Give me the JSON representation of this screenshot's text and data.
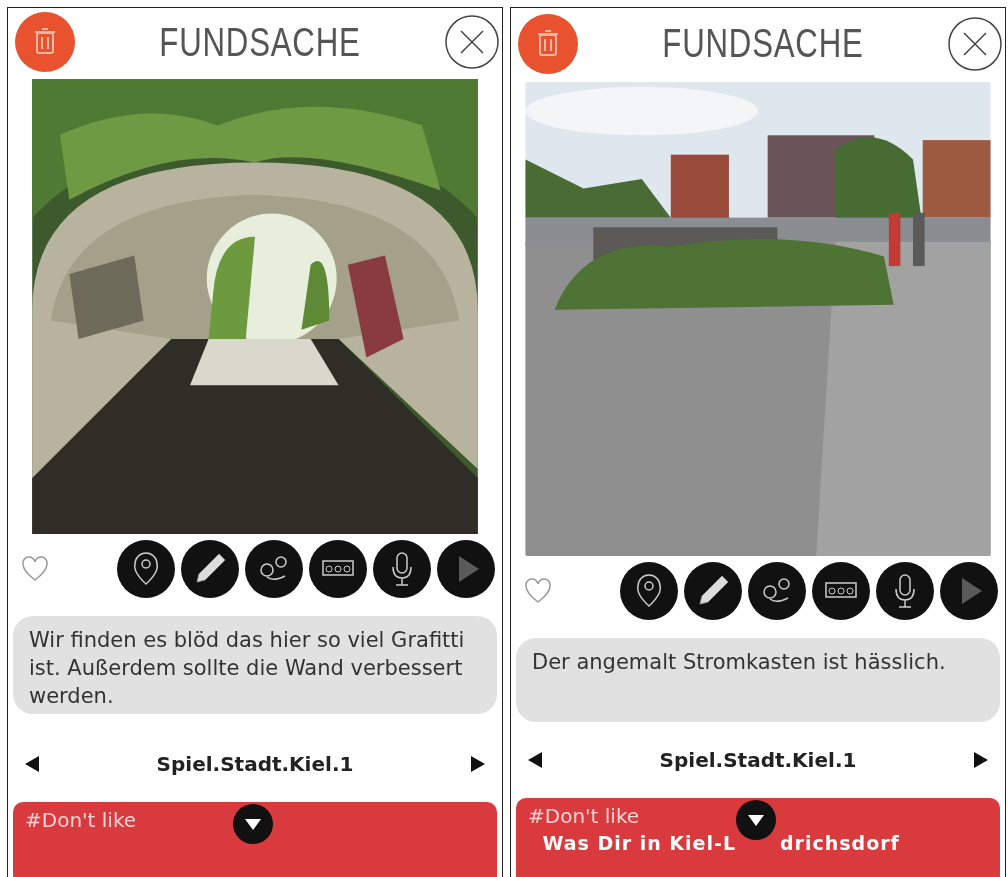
{
  "screens": [
    {
      "title": "FUNDSACHE",
      "comment": "Wir finden es blöd das hier so viel Grafitti ist. Außerdem sollte die Wand verbessert werden.",
      "location": "Spiel.Stadt.Kiel.1",
      "tag": "#Don't like"
    },
    {
      "title": "FUNDSACHE",
      "comment": "Der angemalt Stromkasten ist hässlich.",
      "location": "Spiel.Stadt.Kiel.1",
      "tag": "#Don't like",
      "headline_parts": [
        "Was Dir in Kiel-L",
        "drichsdorf"
      ]
    }
  ]
}
